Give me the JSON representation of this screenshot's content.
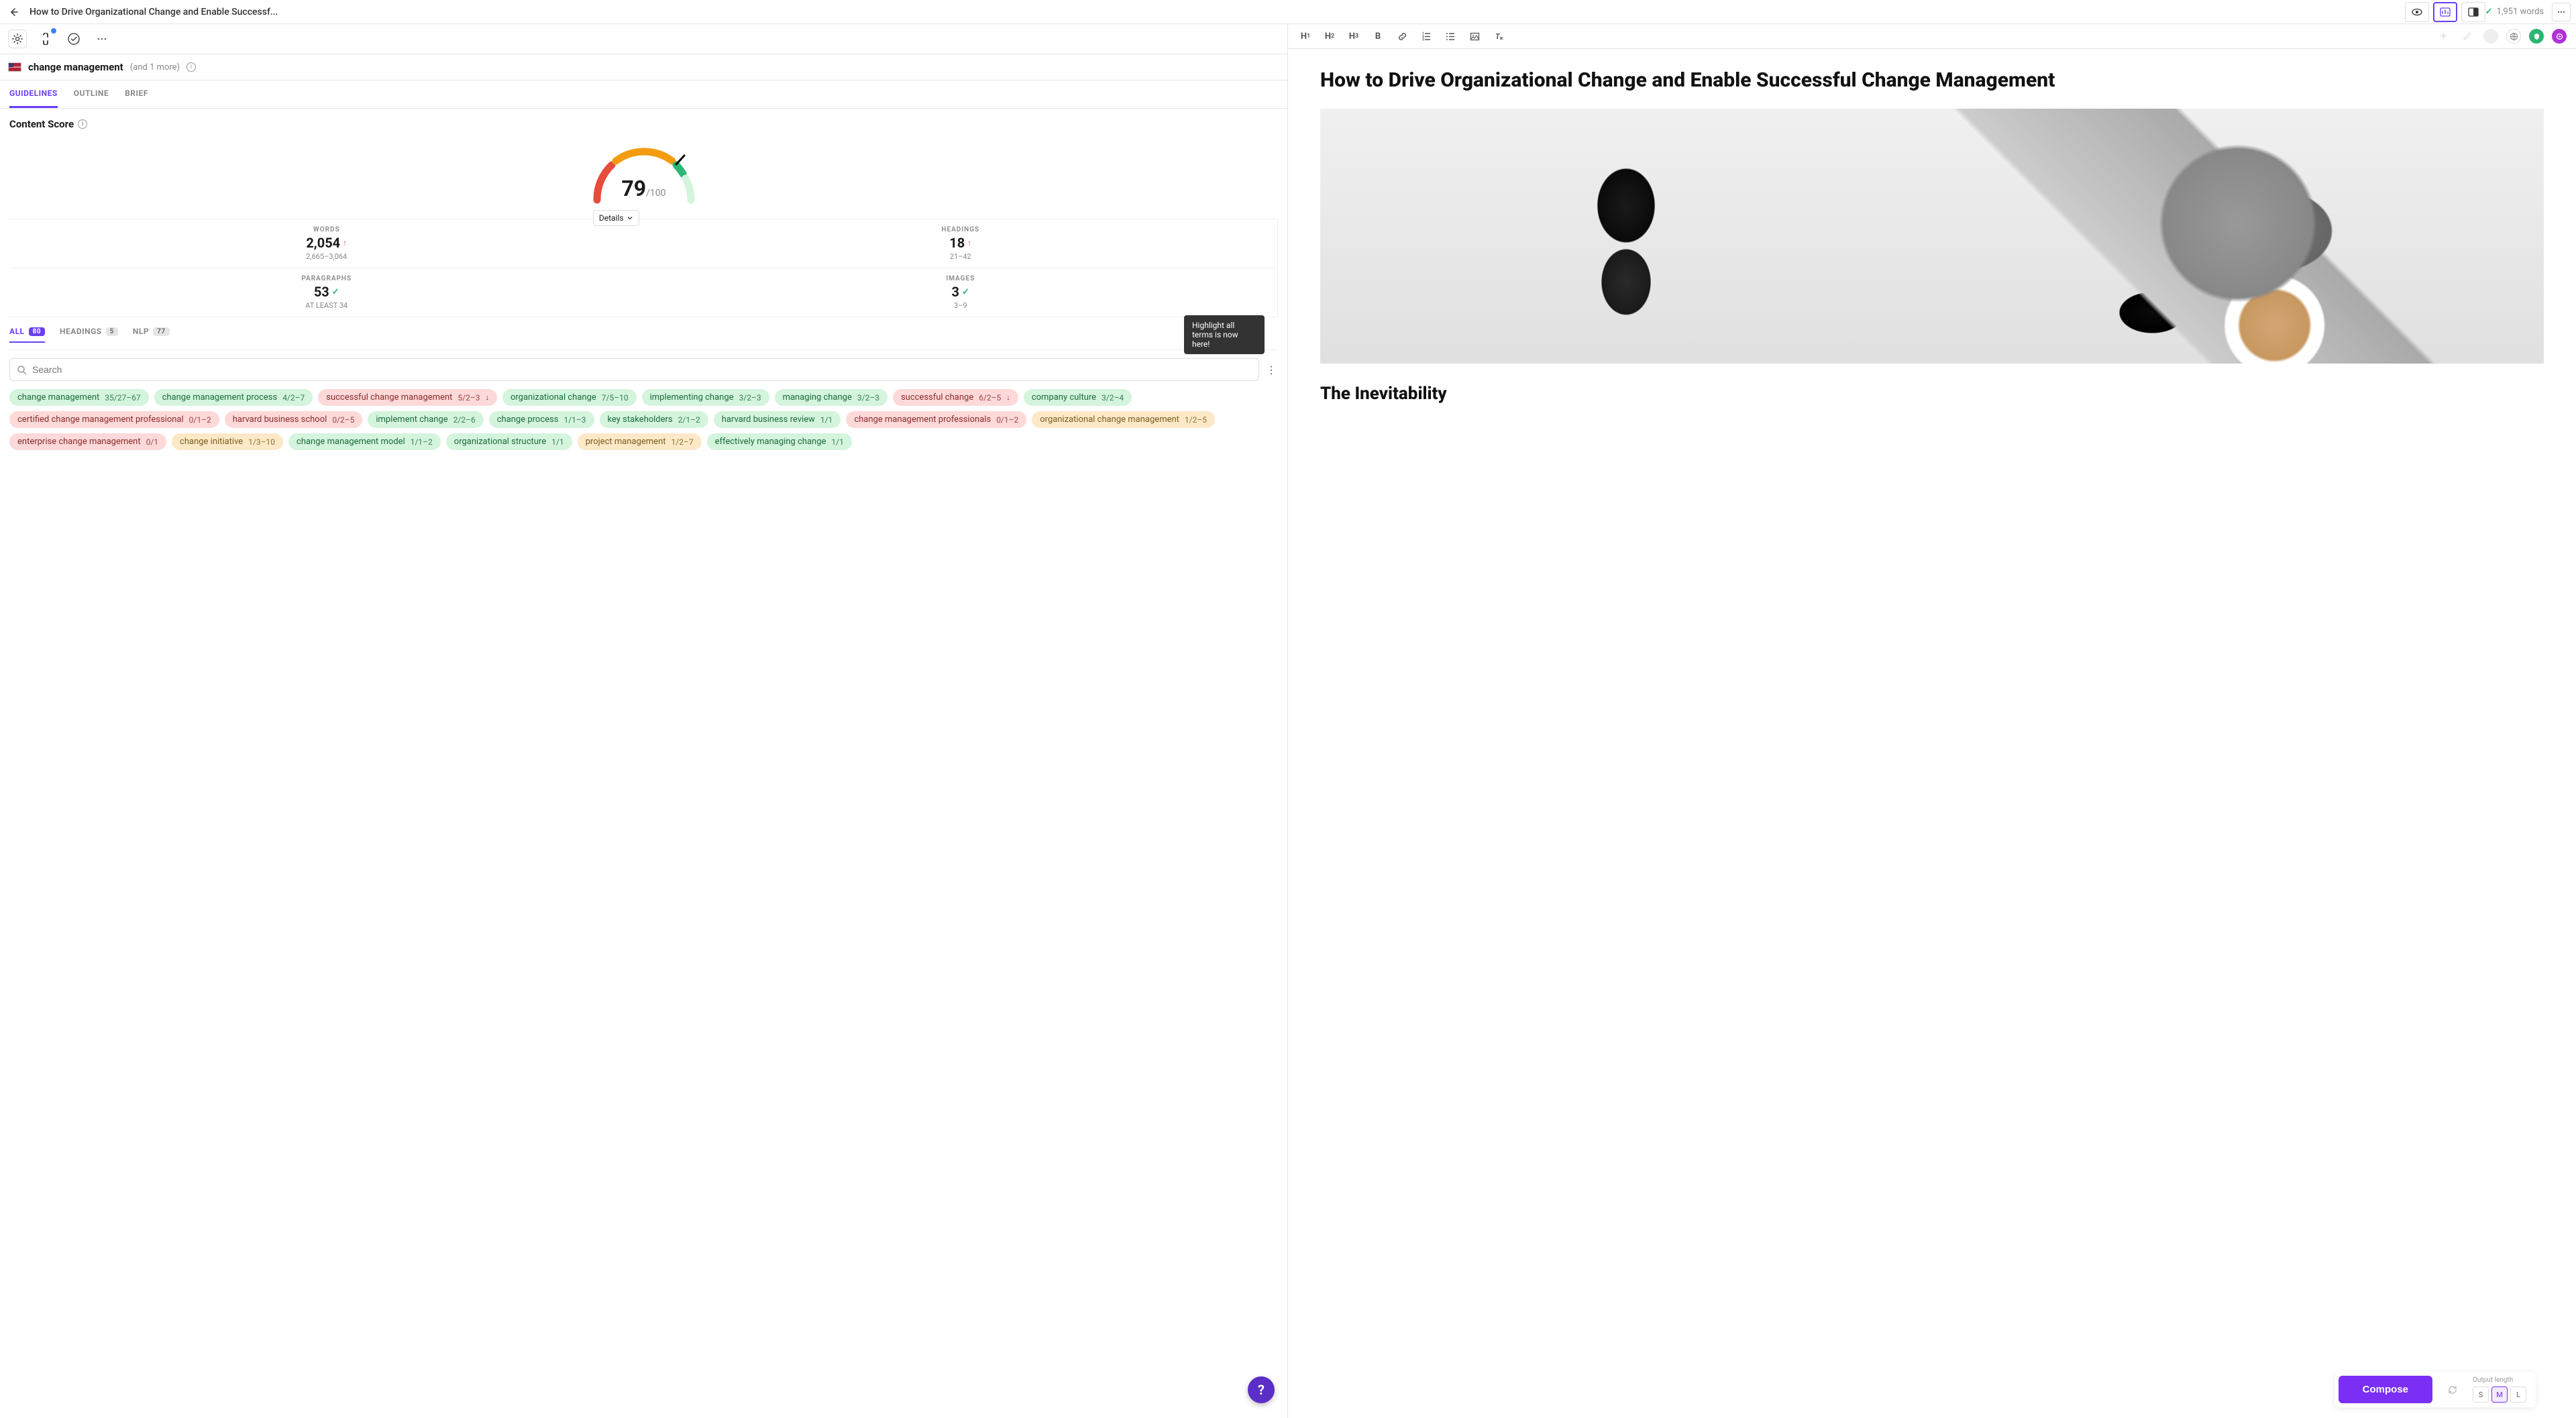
{
  "topbar": {
    "title": "How to Drive Organizational Change and Enable Successf...",
    "word_count": "1,951 words"
  },
  "keyword": {
    "main": "change management",
    "more": "(and 1 more)"
  },
  "tabs": {
    "guidelines": "GUIDELINES",
    "outline": "OUTLINE",
    "brief": "BRIEF"
  },
  "score": {
    "title": "Content Score",
    "value": "79",
    "max": "/100",
    "details_label": "Details"
  },
  "stats": {
    "words": {
      "label": "WORDS",
      "value": "2,054",
      "range": "2,665–3,064",
      "trend": "up"
    },
    "headings": {
      "label": "HEADINGS",
      "value": "18",
      "range": "21–42",
      "trend": "up"
    },
    "paragraphs": {
      "label": "PARAGRAPHS",
      "value": "53",
      "range": "AT LEAST 34",
      "trend": "ok"
    },
    "images": {
      "label": "IMAGES",
      "value": "3",
      "range": "3–9",
      "trend": "ok"
    }
  },
  "filters": {
    "all": {
      "label": "ALL",
      "count": "80"
    },
    "headings": {
      "label": "HEADINGS",
      "count": "5"
    },
    "nlp": {
      "label": "NLP",
      "count": "77"
    }
  },
  "search": {
    "placeholder": "Search"
  },
  "tooltip": "Highlight all terms is now here!",
  "terms": [
    {
      "text": "change management",
      "count": "35/27–67",
      "cls": "green"
    },
    {
      "text": "change management process",
      "count": "4/2–7",
      "cls": "green"
    },
    {
      "text": "successful change management",
      "count": "5/2–3",
      "cls": "red",
      "arrow": "↓"
    },
    {
      "text": "organizational change",
      "count": "7/5–10",
      "cls": "green"
    },
    {
      "text": "implementing change",
      "count": "3/2–3",
      "cls": "green"
    },
    {
      "text": "managing change",
      "count": "3/2–3",
      "cls": "green"
    },
    {
      "text": "successful change",
      "count": "6/2–5",
      "cls": "red",
      "arrow": "↓"
    },
    {
      "text": "company culture",
      "count": "3/2–4",
      "cls": "green"
    },
    {
      "text": "certified change management professional",
      "count": "0/1–2",
      "cls": "red"
    },
    {
      "text": "harvard business school",
      "count": "0/2–5",
      "cls": "red"
    },
    {
      "text": "implement change",
      "count": "2/2–6",
      "cls": "green"
    },
    {
      "text": "change process",
      "count": "1/1–3",
      "cls": "green"
    },
    {
      "text": "key stakeholders",
      "count": "2/1–2",
      "cls": "green"
    },
    {
      "text": "harvard business review",
      "count": "1/1",
      "cls": "green"
    },
    {
      "text": "change management professionals",
      "count": "0/1–2",
      "cls": "red"
    },
    {
      "text": "organizational change management",
      "count": "1/2–5",
      "cls": "yellow"
    },
    {
      "text": "enterprise change management",
      "count": "0/1",
      "cls": "red"
    },
    {
      "text": "change initiative",
      "count": "1/3–10",
      "cls": "yellow"
    },
    {
      "text": "change management model",
      "count": "1/1–2",
      "cls": "green"
    },
    {
      "text": "organizational structure",
      "count": "1/1",
      "cls": "green"
    },
    {
      "text": "project management",
      "count": "1/2–7",
      "cls": "yellow"
    },
    {
      "text": "effectively managing change",
      "count": "1/1",
      "cls": "green"
    }
  ],
  "editor": {
    "h1": "How to Drive Organizational Change and Enable Successful Change Management",
    "h2": "The Inevitability"
  },
  "compose": {
    "button": "Compose",
    "out_len_label": "Output length",
    "opts": {
      "s": "S",
      "m": "M",
      "l": "L"
    }
  },
  "fmt": {
    "h1": "H",
    "h1s": "1",
    "h2": "H",
    "h2s": "2",
    "h3": "H",
    "h3s": "3"
  }
}
